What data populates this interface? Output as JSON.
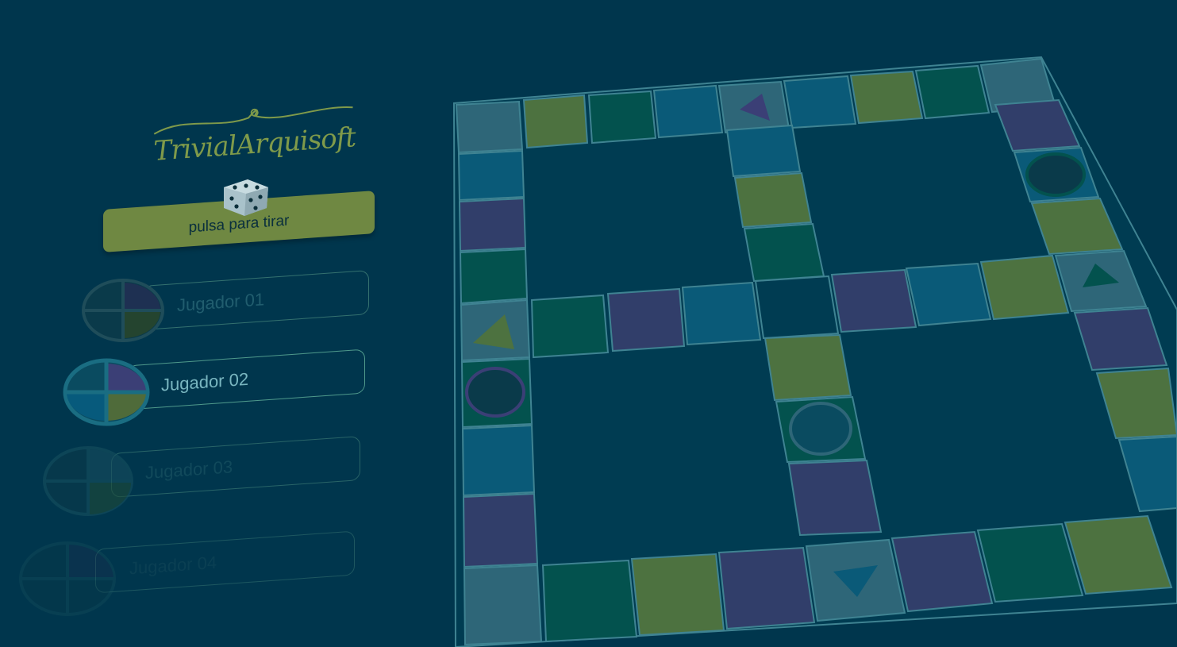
{
  "app": {
    "logo_text": "TrivialArquisoft",
    "roll_button_label": "pulsa para tirar"
  },
  "players": [
    {
      "name": "Jugador 01",
      "active": false
    },
    {
      "name": "Jugador 02",
      "active": true
    },
    {
      "name": "Jugador 03",
      "active": false
    },
    {
      "name": "Jugador 04",
      "active": false
    }
  ],
  "colors": {
    "background": "#00364d",
    "blue": "#0a5a78",
    "green": "#4d7240",
    "teal": "#03524e",
    "purple": "#313e6a",
    "special": "#2e6678",
    "board_line": "#3f8392"
  }
}
